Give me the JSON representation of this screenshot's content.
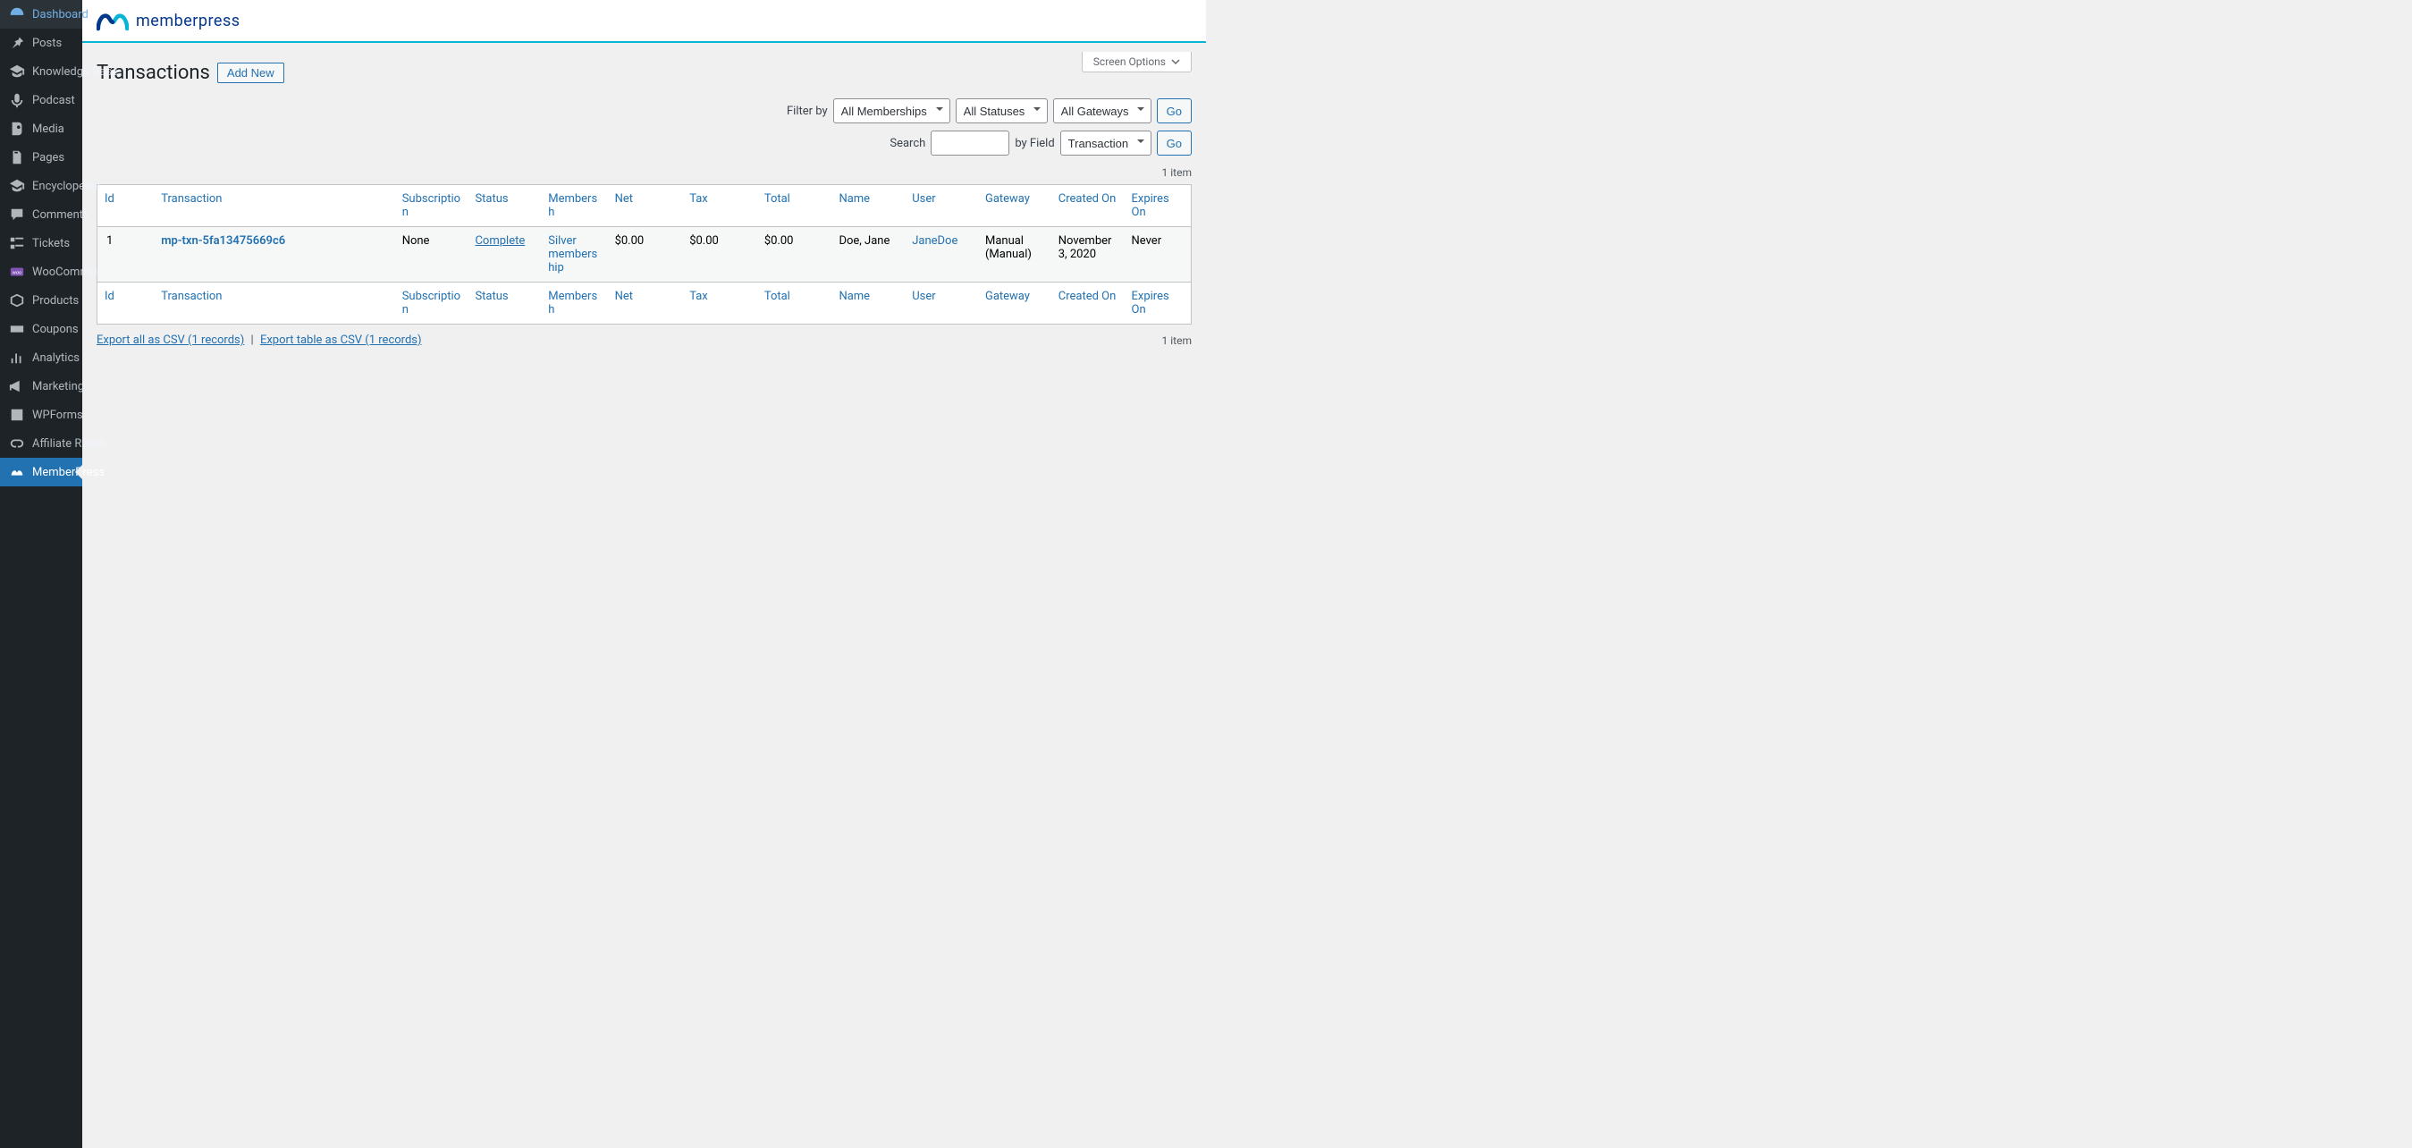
{
  "sidebar": {
    "items": [
      {
        "label": "Dashboard"
      },
      {
        "label": "Posts"
      },
      {
        "label": "Knowledge Base"
      },
      {
        "label": "Podcast"
      },
      {
        "label": "Media"
      },
      {
        "label": "Pages"
      },
      {
        "label": "Encyclopedia"
      },
      {
        "label": "Comments"
      },
      {
        "label": "Tickets"
      },
      {
        "label": "WooCommerce"
      },
      {
        "label": "Products"
      },
      {
        "label": "Coupons"
      },
      {
        "label": "Analytics"
      },
      {
        "label": "Marketing"
      },
      {
        "label": "WPForms"
      },
      {
        "label": "Affiliate Royale"
      },
      {
        "label": "MemberPress"
      }
    ]
  },
  "logo_text": "memberpress",
  "screen_options": "Screen Options",
  "page_title": "Transactions",
  "add_new": "Add New",
  "filters": {
    "filter_by": "Filter by",
    "memberships_selected": "All Memberships",
    "statuses_selected": "All Statuses",
    "gateways_selected": "All Gateways",
    "go": "Go",
    "search_label": "Search",
    "search_value": "",
    "by_field": "by Field",
    "field_selected": "Transaction"
  },
  "item_count": "1 item",
  "columns": {
    "id": "Id",
    "transaction": "Transaction",
    "subscription": "Subscription",
    "status": "Status",
    "membership": "Membersh",
    "net": "Net",
    "tax": "Tax",
    "total": "Total",
    "name": "Name",
    "user": "User",
    "gateway": "Gateway",
    "created": "Created On",
    "expires": "Expires On"
  },
  "rows": [
    {
      "id": "1",
      "transaction": "mp-txn-5fa13475669c6",
      "subscription": "None",
      "status": "Complete",
      "membership": "Silver membership",
      "net": "$0.00",
      "tax": "$0.00",
      "total": "$0.00",
      "name": "Doe, Jane",
      "user": "JaneDoe",
      "gateway": "Manual (Manual)",
      "created": "November 3, 2020",
      "expires": "Never"
    }
  ],
  "export": {
    "all": "Export all as CSV (1 records)",
    "table": "Export table as CSV (1 records)"
  }
}
